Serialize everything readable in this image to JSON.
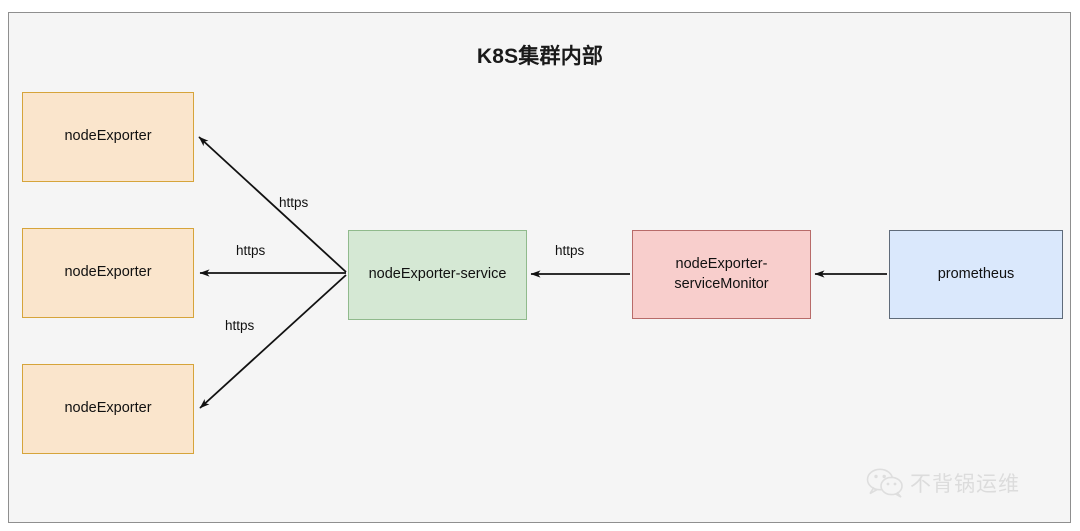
{
  "diagram": {
    "title": "K8S集群内部",
    "background_color": "#f5f5f5",
    "border_color": "#8f8f8f",
    "type": "architecture-flow",
    "nodes": [
      {
        "id": "node-exporter-1",
        "label": "nodeExporter",
        "fill": "#fae5cc",
        "stroke": "#d6a43a"
      },
      {
        "id": "node-exporter-2",
        "label": "nodeExporter",
        "fill": "#fae5cc",
        "stroke": "#d6a43a"
      },
      {
        "id": "node-exporter-3",
        "label": "nodeExporter",
        "fill": "#fae5cc",
        "stroke": "#d6a43a"
      },
      {
        "id": "node-exporter-service",
        "label": "nodeExporter-service",
        "fill": "#d5e8d4",
        "stroke": "#90ba8c"
      },
      {
        "id": "node-exporter-service-monitor",
        "label_line1": "nodeExporter-",
        "label_line2": "serviceMonitor",
        "fill": "#f8cecc",
        "stroke": "#b86b69"
      },
      {
        "id": "prometheus",
        "label": "prometheus",
        "fill": "#dae8fc",
        "stroke": "#5f6b7a"
      }
    ],
    "edges": [
      {
        "from": "node-exporter-service",
        "to": "node-exporter-1",
        "label": "https"
      },
      {
        "from": "node-exporter-service",
        "to": "node-exporter-2",
        "label": "https"
      },
      {
        "from": "node-exporter-service",
        "to": "node-exporter-3",
        "label": "https"
      },
      {
        "from": "node-exporter-service-monitor",
        "to": "node-exporter-service",
        "label": "https"
      },
      {
        "from": "prometheus",
        "to": "node-exporter-service-monitor",
        "label": ""
      }
    ]
  },
  "watermark": {
    "text": "不背锅运维",
    "icon": "wechat-icon",
    "color": "#c9c9c9"
  }
}
